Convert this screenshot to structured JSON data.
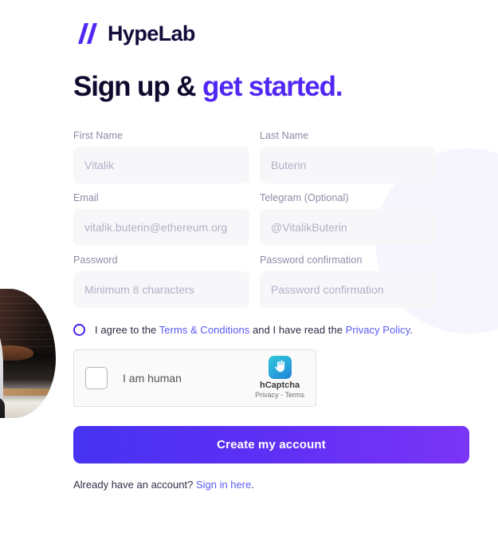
{
  "brand": {
    "name": "HypeLab",
    "mark_icon": "hypelab-slash-logo",
    "logo_color": "#5227f5",
    "name_color": "#130d3b"
  },
  "headline": {
    "lead": "Sign up &",
    "accent": "get started.",
    "accent_color": "#5227f5"
  },
  "form": {
    "fields": [
      {
        "label": "First Name",
        "placeholder": "Vitalik",
        "value": "",
        "type": "text"
      },
      {
        "label": "Last Name",
        "placeholder": "Buterin",
        "value": "",
        "type": "text"
      },
      {
        "label": "Email",
        "placeholder": "vitalik.buterin@ethereum.org",
        "value": "",
        "type": "email"
      },
      {
        "label": "Telegram (Optional)",
        "placeholder": "@VitalikButerin",
        "value": "",
        "type": "text"
      },
      {
        "label": "Password",
        "placeholder": "Minimum 8 characters",
        "value": "",
        "type": "password"
      },
      {
        "label": "Password confirmation",
        "placeholder": "Password confirmation",
        "value": "",
        "type": "password"
      }
    ]
  },
  "terms": {
    "checked": false,
    "text_before": "I agree to the ",
    "terms_link": "Terms & Conditions",
    "text_middle": " and I have read the ",
    "privacy_link": "Privacy Policy",
    "text_after": ".",
    "link_color": "#5b5bf0"
  },
  "captcha": {
    "checked": false,
    "label": "I am human",
    "brand_name": "hCaptcha",
    "links": "Privacy - Terms",
    "logo_icon": "hcaptcha-hand-icon",
    "logo_color": "#2aa7dd"
  },
  "submit": {
    "label": "Create my account",
    "gradient_from": "#4734f2",
    "gradient_to": "#7b35f7"
  },
  "footer": {
    "text": "Already have an account? ",
    "link": "Sign in here",
    "period": "."
  }
}
